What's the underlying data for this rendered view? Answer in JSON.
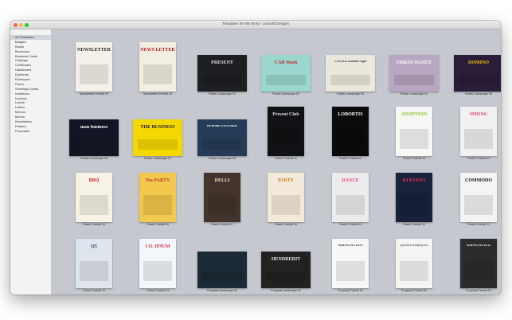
{
  "window": {
    "title": "Templates for MS Word - Jumsoft Designs"
  },
  "sidebar": {
    "items": [
      "All Templates",
      "Badges",
      "Books",
      "Brochures",
      "Business Cards",
      "Catalogs",
      "Certificates",
      "Datasheets",
      "Diplomas",
      "Envelopes",
      "Flyers",
      "Greetings Cards",
      "Invitations",
      "Invoices",
      "Labels",
      "Letters",
      "Memos",
      "Menus",
      "Newsletters",
      "Posters",
      "Proposals"
    ],
    "selected": "All Templates"
  },
  "templates": [
    {
      "caption": "Newsletters Portrait 09",
      "art": "NEWSLETTER",
      "bg": "#f4f1ea",
      "fg": "#222222"
    },
    {
      "caption": "Newsletters Portrait 10",
      "art": "NEWS LETTER",
      "bg": "#f2eee3",
      "fg": "#b31d1d"
    },
    {
      "caption": "Poster Landscape 01",
      "art": "PRESENT",
      "bg": "#1e1f22",
      "fg": "#e0e0e0"
    },
    {
      "caption": "Poster Landscape 02",
      "art": "CAR Wash",
      "bg": "#9ad7cf",
      "fg": "#c62828"
    },
    {
      "caption": "Poster Landscape 03",
      "art": "VINTAGE Karaoke Night",
      "bg": "#ece7dc",
      "fg": "#2f2f2f"
    },
    {
      "caption": "Poster Landscape 04",
      "art": "URBAN DANCE",
      "bg": "#b8a7c2",
      "fg": "#ffffff"
    },
    {
      "caption": "Poster Landscape 05",
      "art": "DOMINO",
      "bg": "#2a1d3a",
      "fg": "#f2c000"
    },
    {
      "caption": "Poster Landscape 06",
      "art": "man business",
      "bg": "#121624",
      "fg": "#ffffff"
    },
    {
      "caption": "Poster Landscape 07",
      "art": "THE BUSINESS",
      "bg": "#f3d900",
      "fg": "#1b1b1b"
    },
    {
      "caption": "Poster Landscape 08",
      "art": "We do this TOGETHER!",
      "bg": "#253c58",
      "fg": "#ffffff"
    },
    {
      "caption": "Poster Portrait 01",
      "art": "Present Club",
      "bg": "#101215",
      "fg": "#d9d9d9"
    },
    {
      "caption": "Poster Portrait 02",
      "art": "LOBORTIS",
      "bg": "#0b0b0b",
      "fg": "#ffffff"
    },
    {
      "caption": "Poster Portrait 03",
      "art": "ADOPTION",
      "bg": "#f7f7f5",
      "fg": "#8cbf2a"
    },
    {
      "caption": "Poster Portrait 04",
      "art": "SPRING",
      "bg": "#f1f1f1",
      "fg": "#d04a7a"
    },
    {
      "caption": "Poster Portrait 05",
      "art": "BBQ",
      "bg": "#f6f2e6",
      "fg": "#d2232a"
    },
    {
      "caption": "Poster Portrait 06",
      "art": "Tea PARTY",
      "bg": "#f2c94c",
      "fg": "#c0392b"
    },
    {
      "caption": "Poster Portrait 07",
      "art": "DELLI",
      "bg": "#43352d",
      "fg": "#f1e6d2"
    },
    {
      "caption": "Poster Portrait 08",
      "art": "PARTY",
      "bg": "#f4ead9",
      "fg": "#c7761e"
    },
    {
      "caption": "Poster Portrait 09",
      "art": "DANCE",
      "bg": "#ececec",
      "fg": "#e53e8c"
    },
    {
      "caption": "Poster Portrait 10",
      "art": "DJ EVENT",
      "bg": "#18223a",
      "fg": "#ff2e63"
    },
    {
      "caption": "Poster Portrait 11",
      "art": "COMMODO",
      "bg": "#f4f4f4",
      "fg": "#111111"
    },
    {
      "caption": "Poster Portrait 12",
      "art": "Q5",
      "bg": "#dfe5ec",
      "fg": "#1f3c66"
    },
    {
      "caption": "Poster Portrait 13",
      "art": "CO. IPSUM",
      "bg": "#f3f6fa",
      "fg": "#d2304f"
    },
    {
      "caption": "Proposal Landscape 01",
      "art": "",
      "bg": "#1b2a35",
      "fg": "#ffffff"
    },
    {
      "caption": "Proposal Landscape 02",
      "art": "HENDRERIT",
      "bg": "#222222",
      "fg": "#e8e8e8"
    },
    {
      "caption": "Proposal Portrait 01",
      "art": "ADIPISCING DUIS",
      "bg": "#f7f7f7",
      "fg": "#333333"
    },
    {
      "caption": "Proposal Portrait 02",
      "art": "QUAM CONSEQUAT",
      "bg": "#f5f4f2",
      "fg": "#444444"
    },
    {
      "caption": "Proposal Portrait 03",
      "art": "ADIPISCING ELIT",
      "bg": "#2c2c2e",
      "fg": "#f0f0f0"
    }
  ]
}
